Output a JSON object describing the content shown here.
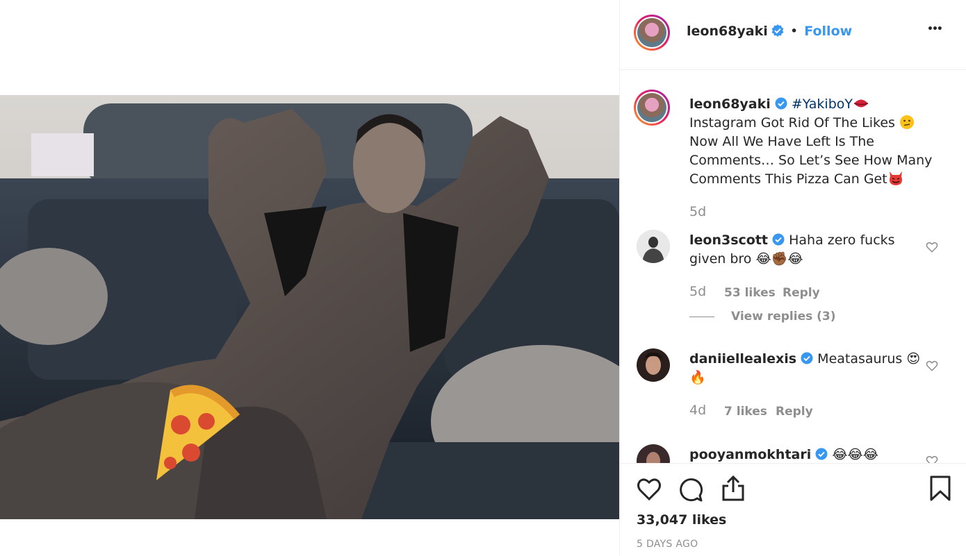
{
  "post": {
    "author": "leon68yaki",
    "separator": "•",
    "follow_label": "Follow",
    "more_label": "•••"
  },
  "caption": {
    "author": "leon68yaki",
    "hashtag": "#YakiboY",
    "text_1": " Instagram Got Rid Of The Likes ",
    "text_2": " Now All We Have Left Is The Comments… So Let’s See How Many Comments This Pizza Can Get",
    "time": "5d"
  },
  "comments": [
    {
      "author": "leon3scott",
      "text": "Haha zero fucks given bro ",
      "emojis": "😂✊🏾😂",
      "time": "5d",
      "likes": "53 likes",
      "reply_label": "Reply",
      "view_replies": "View replies (3)"
    },
    {
      "author": "daniiellealexis",
      "text": "Meatasaurus ",
      "emojis": "😍 🔥",
      "time": "4d",
      "likes": "7 likes",
      "reply_label": "Reply"
    },
    {
      "author": "pooyanmokhtari",
      "emojis": "😂😂😂"
    }
  ],
  "footer": {
    "likes": "33,047 likes",
    "date": "5 DAYS AGO"
  },
  "colors": {
    "link": "#3897f0",
    "verified": "#3897f0",
    "muted": "#8e8e8e"
  },
  "icons": [
    "heart-icon",
    "comment-icon",
    "share-icon",
    "bookmark-icon",
    "verified-badge-icon",
    "kiss-emoji-icon",
    "confused-emoji-icon",
    "devil-emoji-icon",
    "pizza-icon"
  ]
}
